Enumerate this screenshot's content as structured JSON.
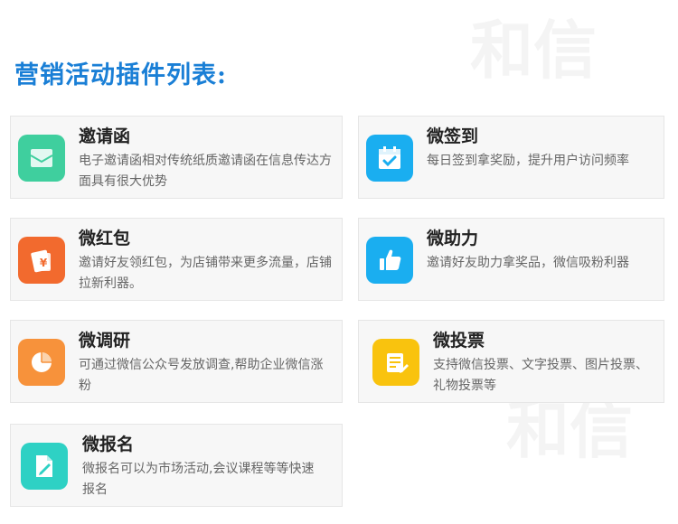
{
  "heading": "营销活动插件列表:",
  "plugins": [
    {
      "id": "invitation",
      "title": "邀请函",
      "desc": "电子邀请函相对传统纸质邀请函在信息传达方面具有很大优势",
      "icon": "envelope-icon",
      "color": "#3fcf9e"
    },
    {
      "id": "checkin",
      "title": "微签到",
      "desc": "每日签到拿奖励，提升用户访问频率",
      "icon": "calendar-check-icon",
      "color": "#1aaef0"
    },
    {
      "id": "redpacket",
      "title": "微红包",
      "desc": "邀请好友领红包，为店铺带来更多流量，店铺拉新利器。",
      "icon": "red-packet-icon",
      "color": "#f26a2e"
    },
    {
      "id": "boost",
      "title": "微助力",
      "desc": "邀请好友助力拿奖品，微信吸粉利器",
      "icon": "thumbs-up-icon",
      "color": "#1aaef0"
    },
    {
      "id": "survey",
      "title": "微调研",
      "desc": "可通过微信公众号发放调查,帮助企业微信涨粉",
      "icon": "pie-chart-icon",
      "color": "#f7923b"
    },
    {
      "id": "vote",
      "title": "微投票",
      "desc": "支持微信投票、文字投票、图片投票、礼物投票等",
      "icon": "vote-document-icon",
      "color": "#f9c30e"
    },
    {
      "id": "signup",
      "title": "微报名",
      "desc": "微报名可以为市场活动,会议课程等等快速报名",
      "icon": "signup-document-icon",
      "color": "#2ed1c4"
    }
  ]
}
